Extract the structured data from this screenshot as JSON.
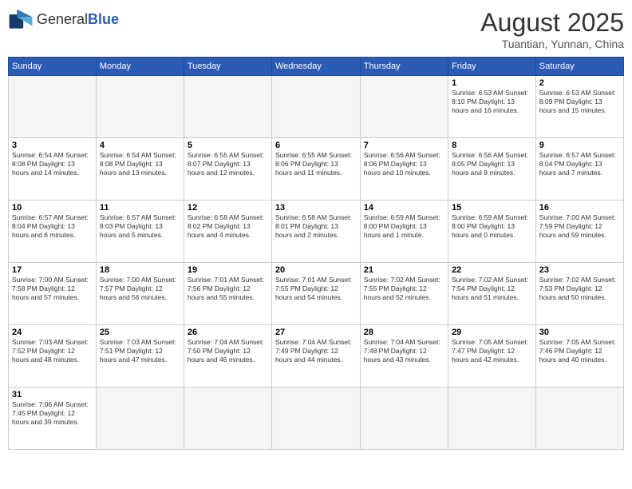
{
  "header": {
    "logo_general": "General",
    "logo_blue": "Blue",
    "title": "August 2025",
    "subtitle": "Tuantian, Yunnan, China"
  },
  "days_header": [
    "Sunday",
    "Monday",
    "Tuesday",
    "Wednesday",
    "Thursday",
    "Friday",
    "Saturday"
  ],
  "weeks": [
    [
      {
        "num": "",
        "info": "",
        "empty": true
      },
      {
        "num": "",
        "info": "",
        "empty": true
      },
      {
        "num": "",
        "info": "",
        "empty": true
      },
      {
        "num": "",
        "info": "",
        "empty": true
      },
      {
        "num": "",
        "info": "",
        "empty": true
      },
      {
        "num": "1",
        "info": "Sunrise: 6:53 AM\nSunset: 8:10 PM\nDaylight: 13 hours and 16 minutes."
      },
      {
        "num": "2",
        "info": "Sunrise: 6:53 AM\nSunset: 8:09 PM\nDaylight: 13 hours and 15 minutes."
      }
    ],
    [
      {
        "num": "3",
        "info": "Sunrise: 6:54 AM\nSunset: 8:08 PM\nDaylight: 13 hours and 14 minutes."
      },
      {
        "num": "4",
        "info": "Sunrise: 6:54 AM\nSunset: 8:08 PM\nDaylight: 13 hours and 13 minutes."
      },
      {
        "num": "5",
        "info": "Sunrise: 6:55 AM\nSunset: 8:07 PM\nDaylight: 13 hours and 12 minutes."
      },
      {
        "num": "6",
        "info": "Sunrise: 6:55 AM\nSunset: 8:06 PM\nDaylight: 13 hours and 11 minutes."
      },
      {
        "num": "7",
        "info": "Sunrise: 6:56 AM\nSunset: 8:06 PM\nDaylight: 13 hours and 10 minutes."
      },
      {
        "num": "8",
        "info": "Sunrise: 6:56 AM\nSunset: 8:05 PM\nDaylight: 13 hours and 8 minutes."
      },
      {
        "num": "9",
        "info": "Sunrise: 6:57 AM\nSunset: 8:04 PM\nDaylight: 13 hours and 7 minutes."
      }
    ],
    [
      {
        "num": "10",
        "info": "Sunrise: 6:57 AM\nSunset: 8:04 PM\nDaylight: 13 hours and 6 minutes."
      },
      {
        "num": "11",
        "info": "Sunrise: 6:57 AM\nSunset: 8:03 PM\nDaylight: 13 hours and 5 minutes."
      },
      {
        "num": "12",
        "info": "Sunrise: 6:58 AM\nSunset: 8:02 PM\nDaylight: 13 hours and 4 minutes."
      },
      {
        "num": "13",
        "info": "Sunrise: 6:58 AM\nSunset: 8:01 PM\nDaylight: 13 hours and 2 minutes."
      },
      {
        "num": "14",
        "info": "Sunrise: 6:59 AM\nSunset: 8:00 PM\nDaylight: 13 hours and 1 minute."
      },
      {
        "num": "15",
        "info": "Sunrise: 6:59 AM\nSunset: 8:00 PM\nDaylight: 13 hours and 0 minutes."
      },
      {
        "num": "16",
        "info": "Sunrise: 7:00 AM\nSunset: 7:59 PM\nDaylight: 12 hours and 59 minutes."
      }
    ],
    [
      {
        "num": "17",
        "info": "Sunrise: 7:00 AM\nSunset: 7:58 PM\nDaylight: 12 hours and 57 minutes."
      },
      {
        "num": "18",
        "info": "Sunrise: 7:00 AM\nSunset: 7:57 PM\nDaylight: 12 hours and 56 minutes."
      },
      {
        "num": "19",
        "info": "Sunrise: 7:01 AM\nSunset: 7:56 PM\nDaylight: 12 hours and 55 minutes."
      },
      {
        "num": "20",
        "info": "Sunrise: 7:01 AM\nSunset: 7:55 PM\nDaylight: 12 hours and 54 minutes."
      },
      {
        "num": "21",
        "info": "Sunrise: 7:02 AM\nSunset: 7:55 PM\nDaylight: 12 hours and 52 minutes."
      },
      {
        "num": "22",
        "info": "Sunrise: 7:02 AM\nSunset: 7:54 PM\nDaylight: 12 hours and 51 minutes."
      },
      {
        "num": "23",
        "info": "Sunrise: 7:02 AM\nSunset: 7:53 PM\nDaylight: 12 hours and 50 minutes."
      }
    ],
    [
      {
        "num": "24",
        "info": "Sunrise: 7:03 AM\nSunset: 7:52 PM\nDaylight: 12 hours and 48 minutes."
      },
      {
        "num": "25",
        "info": "Sunrise: 7:03 AM\nSunset: 7:51 PM\nDaylight: 12 hours and 47 minutes."
      },
      {
        "num": "26",
        "info": "Sunrise: 7:04 AM\nSunset: 7:50 PM\nDaylight: 12 hours and 46 minutes."
      },
      {
        "num": "27",
        "info": "Sunrise: 7:04 AM\nSunset: 7:49 PM\nDaylight: 12 hours and 44 minutes."
      },
      {
        "num": "28",
        "info": "Sunrise: 7:04 AM\nSunset: 7:48 PM\nDaylight: 12 hours and 43 minutes."
      },
      {
        "num": "29",
        "info": "Sunrise: 7:05 AM\nSunset: 7:47 PM\nDaylight: 12 hours and 42 minutes."
      },
      {
        "num": "30",
        "info": "Sunrise: 7:05 AM\nSunset: 7:46 PM\nDaylight: 12 hours and 40 minutes."
      }
    ],
    [
      {
        "num": "31",
        "info": "Sunrise: 7:06 AM\nSunset: 7:45 PM\nDaylight: 12 hours and 39 minutes."
      },
      {
        "num": "",
        "info": "",
        "empty": true
      },
      {
        "num": "",
        "info": "",
        "empty": true
      },
      {
        "num": "",
        "info": "",
        "empty": true
      },
      {
        "num": "",
        "info": "",
        "empty": true
      },
      {
        "num": "",
        "info": "",
        "empty": true
      },
      {
        "num": "",
        "info": "",
        "empty": true
      }
    ]
  ]
}
